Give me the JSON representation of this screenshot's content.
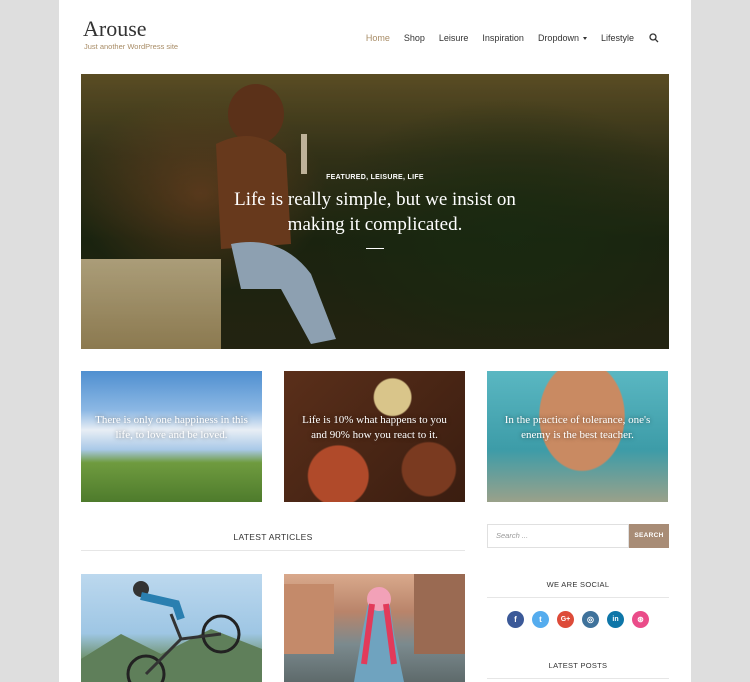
{
  "site": {
    "title": "Arouse",
    "tagline": "Just another WordPress site"
  },
  "nav": {
    "items": [
      "Home",
      "Shop",
      "Leisure",
      "Inspiration",
      "Dropdown",
      "Lifestyle"
    ],
    "active": "Home"
  },
  "hero": {
    "categories": "FEATURED, LEISURE, LIFE",
    "quote": "Life is really simple, but we insist on making it complicated."
  },
  "promos": [
    {
      "text": "There is only one happiness in this life, to love and be loved."
    },
    {
      "text": "Life is 10% what happens to you and 90% how you react to it."
    },
    {
      "text": "In the practice of tolerance, one's enemy is the best teacher."
    }
  ],
  "latest_articles": {
    "title": "LATEST ARTICLES"
  },
  "sidebar": {
    "search_placeholder": "Search ...",
    "search_button": "SEARCH",
    "social_title": "WE ARE SOCIAL",
    "latest_posts_title": "LATEST POSTS",
    "social": [
      {
        "icon": "facebook-icon",
        "glyph": "f",
        "color": "#3b5998"
      },
      {
        "icon": "twitter-icon",
        "glyph": "t",
        "color": "#55acee"
      },
      {
        "icon": "google-plus-icon",
        "glyph": "G+",
        "color": "#dd4b39"
      },
      {
        "icon": "instagram-icon",
        "glyph": "◎",
        "color": "#3f729b"
      },
      {
        "icon": "linkedin-icon",
        "glyph": "in",
        "color": "#0e76a8"
      },
      {
        "icon": "dribbble-icon",
        "glyph": "⊛",
        "color": "#ea4c89"
      }
    ]
  },
  "colors": {
    "accent": "#a88c66",
    "button": "#a88c76"
  }
}
